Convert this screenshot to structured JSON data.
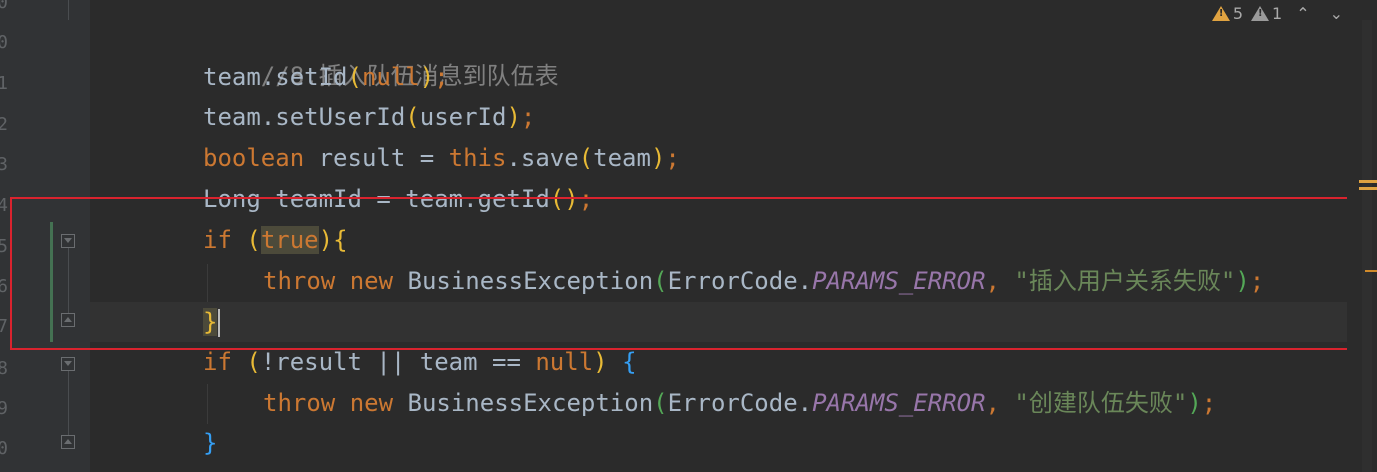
{
  "gutter": {
    "line_numbers": [
      "0",
      "1",
      "2",
      "3",
      "4",
      "5",
      "6",
      "7",
      "8",
      "9",
      "0"
    ]
  },
  "code": {
    "line1": {
      "comment": "//8.插入队伍消息到队伍表"
    },
    "line2": {
      "a": "team.setId",
      "b": "(",
      "c": "null",
      "d": ")",
      "e": ";"
    },
    "line3": {
      "a": "team.setUserId",
      "b": "(",
      "c": "userId",
      "d": ")",
      "e": ";"
    },
    "line4": {
      "a": "boolean",
      "b": " result = ",
      "c": "this",
      "d": ".save",
      "e": "(",
      "f": "team",
      "g": ")",
      "h": ";"
    },
    "line5": {
      "a": "Long teamId = team.getId",
      "b": "()",
      "c": ";"
    },
    "line6": {
      "a": "if",
      "b": " ",
      "c": "(",
      "d": "true",
      "e": ")",
      "f": "{"
    },
    "line7": {
      "a": "throw",
      "b": " ",
      "c": "new",
      "d": " BusinessException",
      "e": "(",
      "f": "ErrorCode.",
      "g": "PARAMS_ERROR",
      "h": ", ",
      "i": "\"插入用户关系失败\"",
      "j": ")",
      "k": ";"
    },
    "line8": {
      "a": "}"
    },
    "line9": {
      "a": "if",
      "b": " ",
      "c": "(",
      "d": "!result || team == ",
      "e": "null",
      "f": ")",
      "g": " ",
      "h": "{"
    },
    "line10": {
      "a": "throw",
      "b": " ",
      "c": "new",
      "d": " BusinessException",
      "e": "(",
      "f": "ErrorCode.",
      "g": "PARAMS_ERROR",
      "h": ", ",
      "i": "\"创建队伍失败\"",
      "j": ")",
      "k": ";"
    },
    "line11": {
      "a": "}"
    }
  },
  "inspections": {
    "warnings_count": "5",
    "weak_warnings_count": "1",
    "warning_icon": "warning-triangle-icon",
    "weak_warning_icon": "weak-warning-triangle-icon",
    "prev_icon": "chevron-up-icon",
    "next_icon": "chevron-down-icon",
    "prev_glyph": "⌃",
    "next_glyph": "⌄"
  },
  "colors": {
    "background": "#2b2b2b",
    "keyword": "#cc7832",
    "comment": "#808080",
    "string": "#6a8759",
    "constant": "#9876aa",
    "highlight_box": "#d9232e"
  }
}
